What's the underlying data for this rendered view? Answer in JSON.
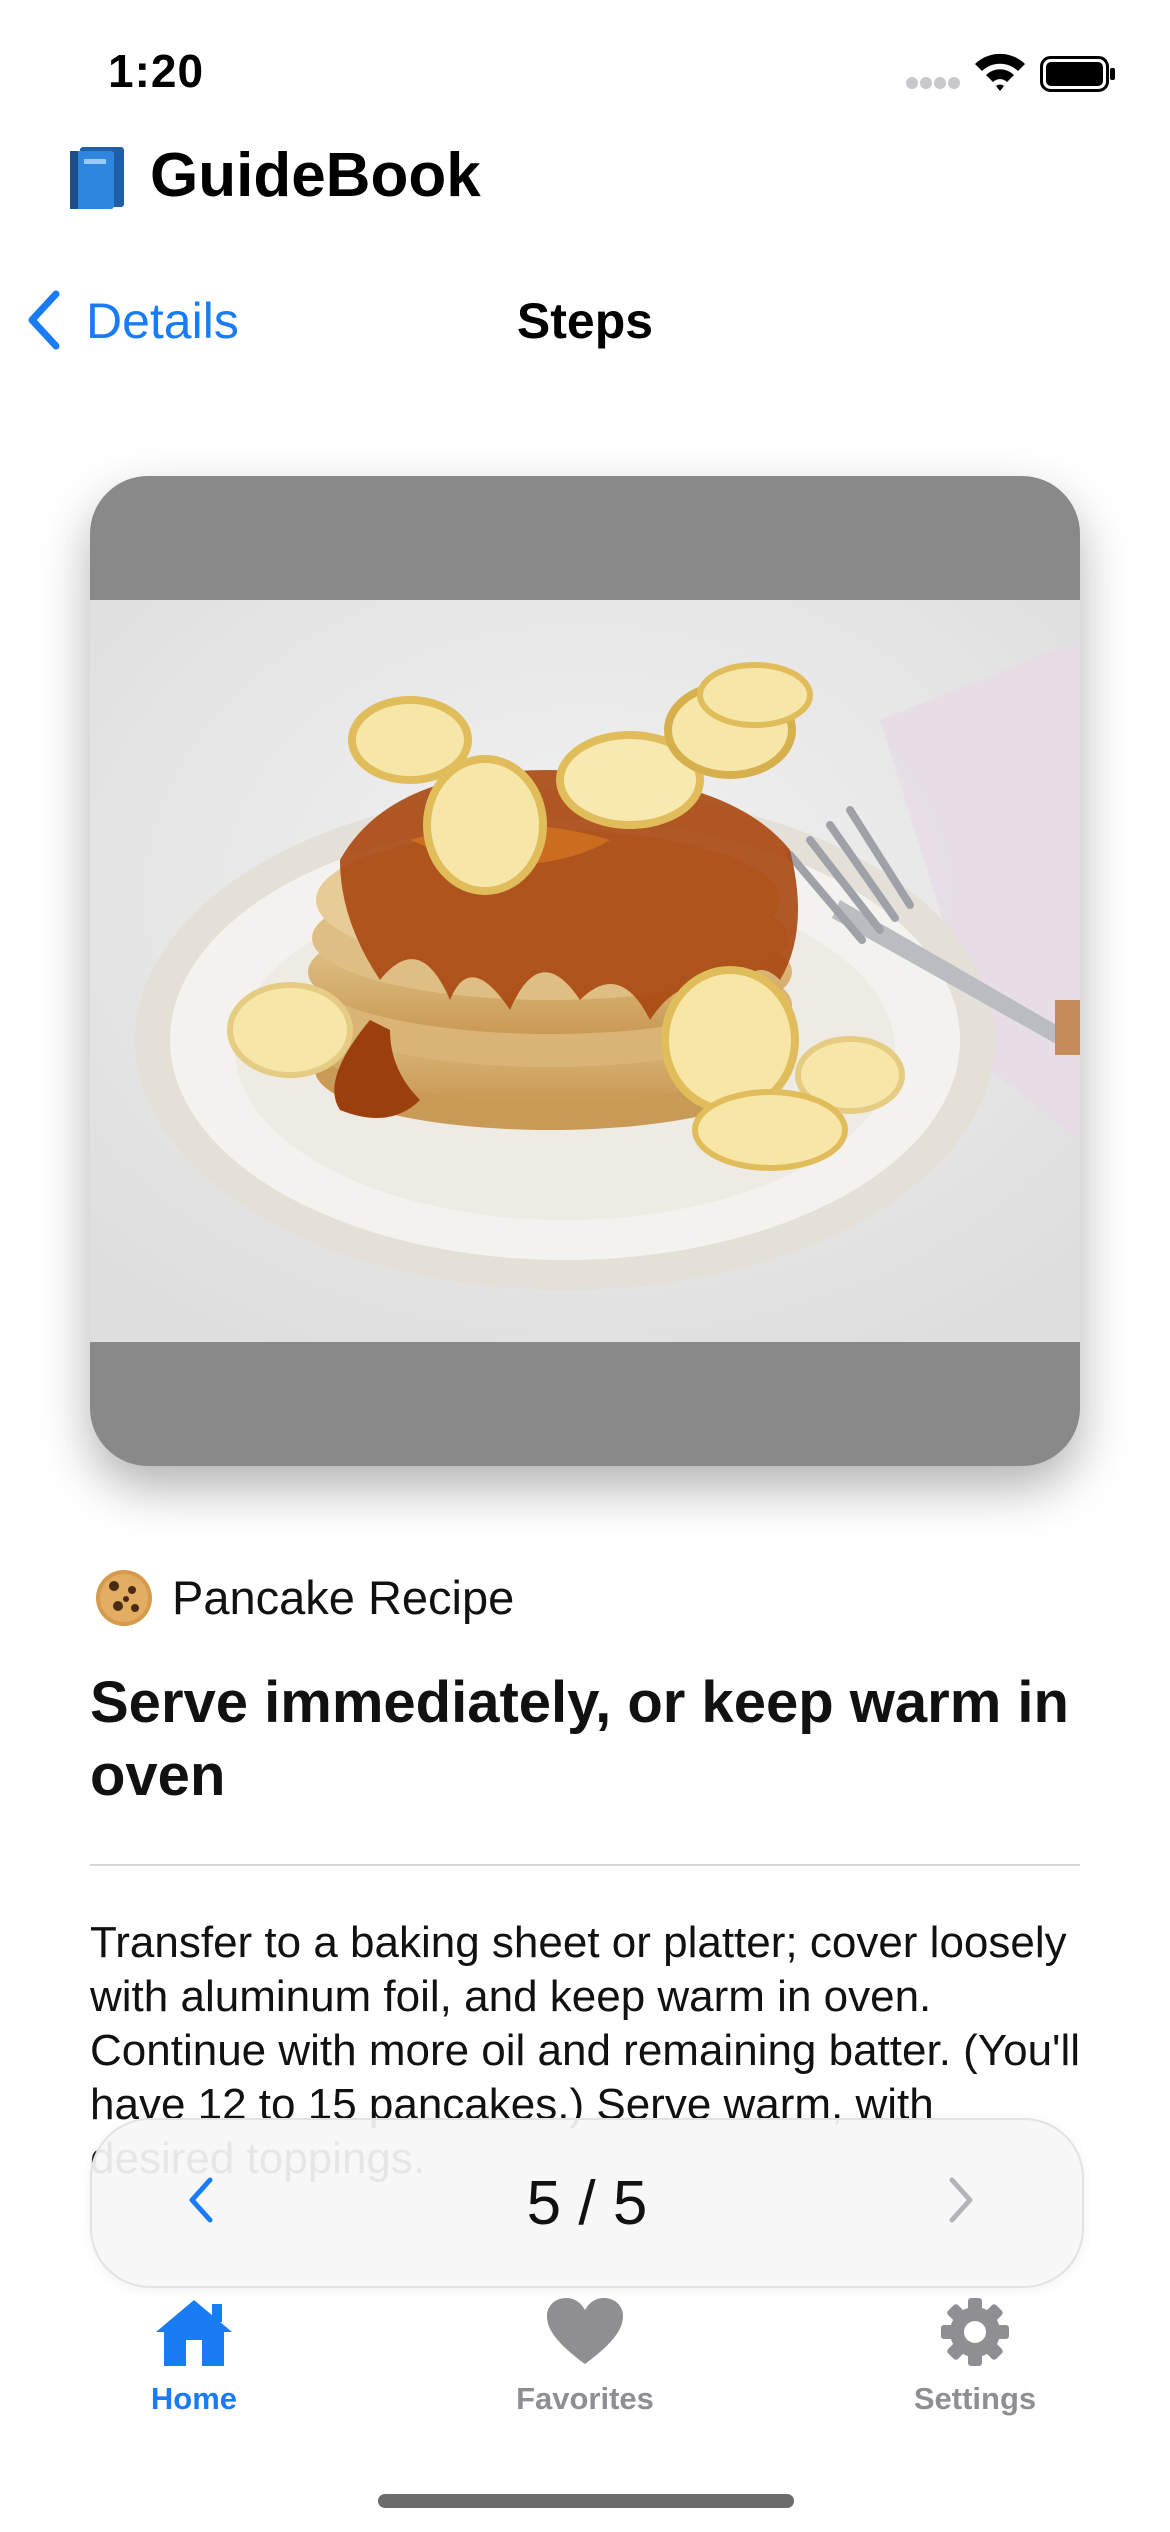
{
  "status_bar": {
    "time": "1:20"
  },
  "app": {
    "title": "GuideBook",
    "logo_icon": "blue-book-icon"
  },
  "nav": {
    "back_label": "Details",
    "title": "Steps"
  },
  "recipe": {
    "category_icon": "cookie-icon",
    "name": "Pancake Recipe",
    "step_title": "Serve immediately, or keep warm in oven",
    "step_body": "Transfer to a baking sheet or platter; cover loosely with aluminum foil, and keep warm in oven. Continue with more oil and remaining batter. (You'll have 12 to 15 pancakes.) Serve warm, with desired toppings."
  },
  "pager": {
    "label": "5 / 5",
    "current": 5,
    "total": 5
  },
  "tabs": [
    {
      "label": "Home",
      "icon": "house-icon",
      "active": true
    },
    {
      "label": "Favorites",
      "icon": "heart-icon",
      "active": false
    },
    {
      "label": "Settings",
      "icon": "gear-icon",
      "active": false
    }
  ],
  "colors": {
    "accent": "#1a7cf4",
    "inactive": "#8e8e93",
    "card_background": "#898989"
  }
}
